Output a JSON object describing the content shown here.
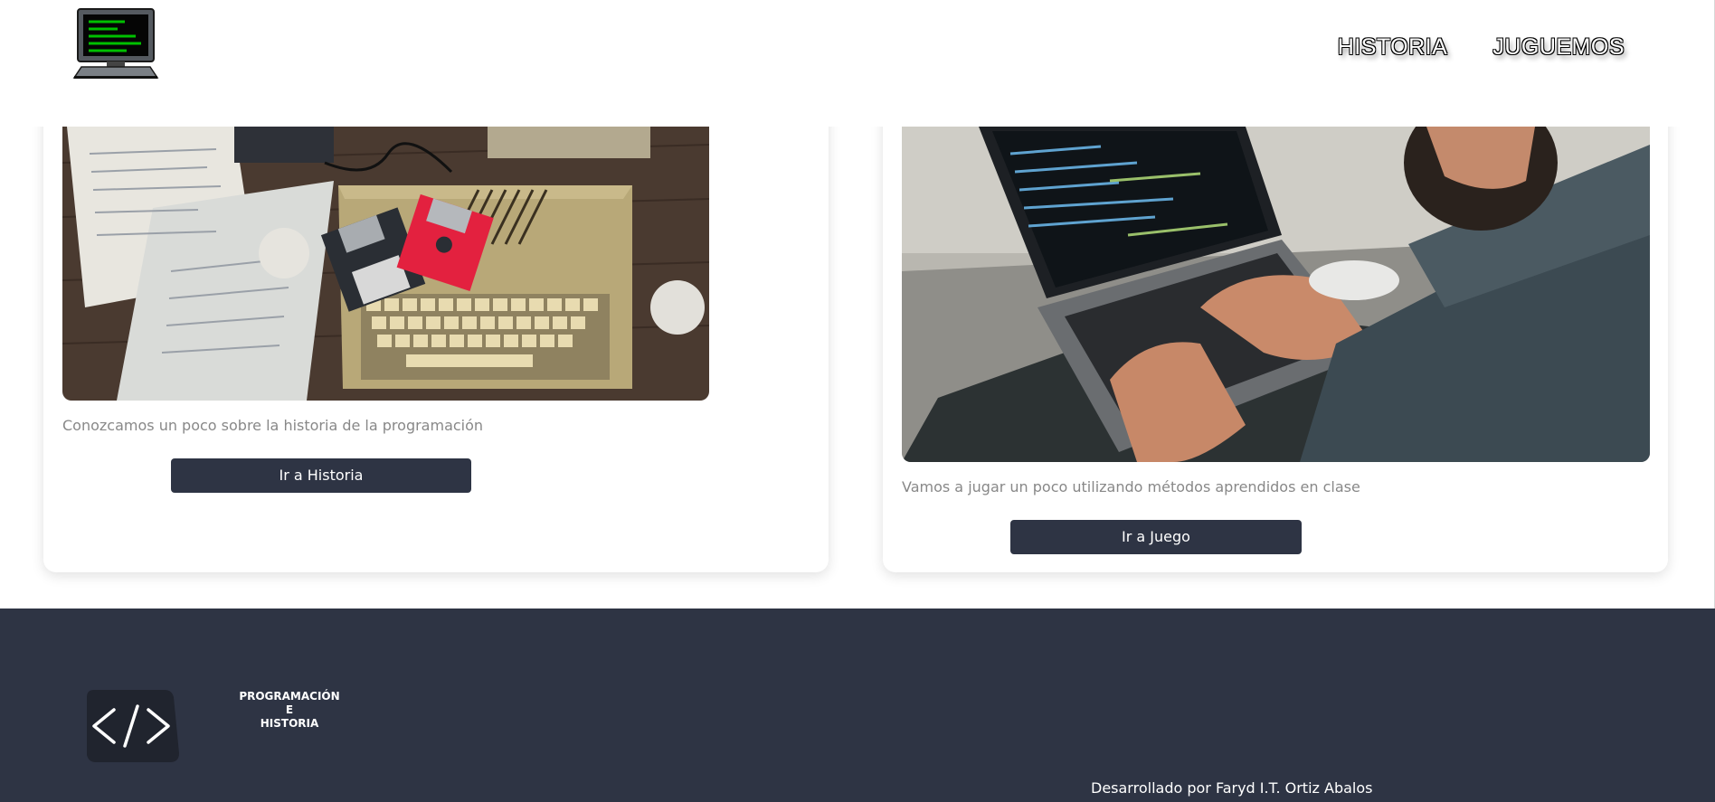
{
  "header": {
    "logo_icon": "computer-monitor-icon",
    "nav": [
      {
        "label": "HISTORIA"
      },
      {
        "label": "JUGUEMOS"
      }
    ]
  },
  "cards": [
    {
      "image": "retro-computer-floppy-disks-photo",
      "description": "Conozcamos un poco sobre la historia de la programación",
      "button_label": "Ir a Historia"
    },
    {
      "image": "person-coding-on-laptop-photo",
      "description": "Vamos a jugar un poco utilizando métodos aprendidos en clase",
      "button_label": "Ir a Juego"
    }
  ],
  "footer": {
    "logo_icon": "code-brackets-icon",
    "title_lines": [
      "PROGRAMACIÓN",
      "E",
      "HISTORIA"
    ],
    "credit": "Desarrollado por Faryd I.T. Ortiz Abalos"
  },
  "colors": {
    "primary_dark": "#2e3444",
    "text_muted": "#888888",
    "screen_green": "#00c000"
  }
}
